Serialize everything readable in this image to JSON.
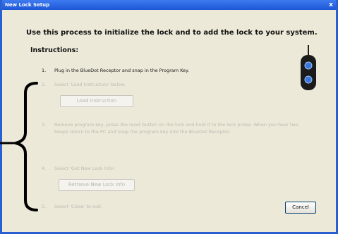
{
  "window": {
    "title": "New Lock Setup",
    "close_glyph": "x"
  },
  "content": {
    "intro": "Use this process to initialize the lock and to add the lock to your system.",
    "instructions_title": "Instructions:",
    "steps": [
      {
        "num": "1.",
        "text": "Plug in the BlueDot Receptor and snap in the Program Key.",
        "active": true
      },
      {
        "num": "2.",
        "text": "Select 'Load Instruction' below.",
        "active": false
      },
      {
        "num": "3.",
        "text": "Remove program key, press the reset button on the lock and hold it to the lock probe.  When you hear two beeps return to the PC and snap the program key into the BlueDot Receptor.",
        "active": false
      },
      {
        "num": "4.",
        "text": "Select 'Get New Lock Info'.",
        "active": false
      },
      {
        "num": "5.",
        "text": "Select 'Close' to exit.",
        "active": false
      }
    ],
    "load_button": "Load Instruction",
    "retrieve_button": "Retrieve New Lock Info",
    "cancel_button": "Cancel"
  },
  "icons": {
    "device": "program-key-device-icon",
    "annotation": "bracket-annotation"
  },
  "colors": {
    "titlebar": "#1e56d6",
    "dialog_bg": "#ece9d8",
    "disabled_text": "#bdbab3"
  }
}
